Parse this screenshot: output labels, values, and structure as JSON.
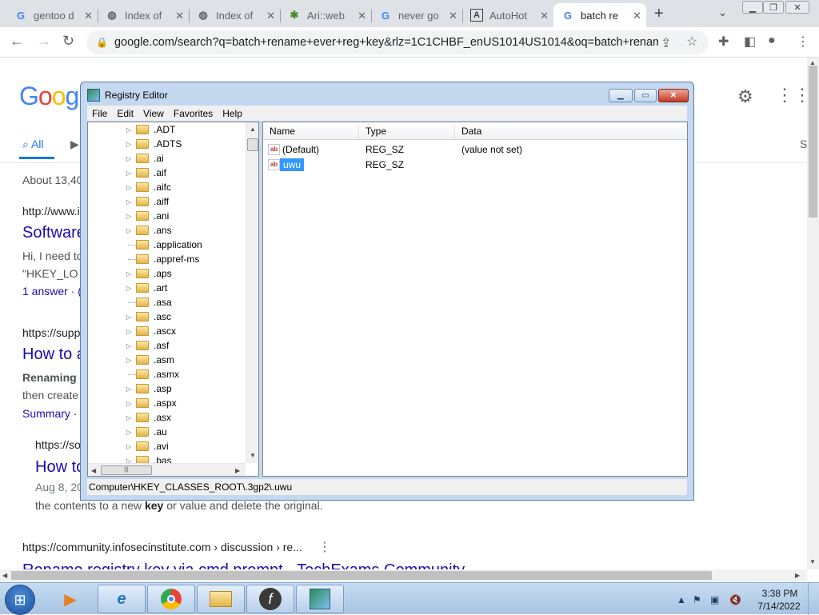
{
  "browser": {
    "tabs": [
      {
        "title": "gentoo d",
        "icon": "google-icon",
        "active": false
      },
      {
        "title": "Index of",
        "icon": "globe-icon",
        "active": false
      },
      {
        "title": "Index of",
        "icon": "globe-icon",
        "active": false
      },
      {
        "title": "Ari::web",
        "icon": "aria-icon",
        "active": false
      },
      {
        "title": "never go",
        "icon": "google-icon",
        "active": false
      },
      {
        "title": "AutoHot",
        "icon": "autohotkey-icon",
        "active": false
      },
      {
        "title": "batch re",
        "icon": "google-icon",
        "active": true
      }
    ],
    "url": "google.com/search?q=batch+rename+ever+reg+key&rlz=1C1CHBF_enUS1014US1014&oq=batch+renam..."
  },
  "google": {
    "logo": "Google",
    "tab_all": "All",
    "results_count": "About 13,40",
    "tab_s": "S",
    "results": [
      {
        "cite": "http://www.i",
        "title": "Software",
        "snippet1": "Hi, I need to",
        "snippet2": "\"HKEY_LO",
        "meta": "1 answer · ("
      },
      {
        "cite": "https://supp",
        "title": "How to a",
        "snippet1": "Renaming R",
        "snippet2": "then create",
        "meta": "Summary ·"
      },
      {
        "cite": "https://so",
        "title": "How to",
        "date": "Aug 8, 20",
        "snippet_full_a": "the contents to a new ",
        "snippet_key": "key",
        "snippet_full_b": " or value and delete the original."
      },
      {
        "cite": "https://community.infosecinstitute.com › discussion › re...",
        "title": "Rename registry key via cmd prompt - TechExams Community"
      }
    ]
  },
  "regedit": {
    "title": "Registry Editor",
    "menu": [
      "File",
      "Edit",
      "View",
      "Favorites",
      "Help"
    ],
    "tree": [
      {
        "label": ".ADT",
        "expandable": true
      },
      {
        "label": ".ADTS",
        "expandable": true
      },
      {
        "label": ".ai",
        "expandable": true
      },
      {
        "label": ".aif",
        "expandable": true
      },
      {
        "label": ".aifc",
        "expandable": true
      },
      {
        "label": ".aiff",
        "expandable": true
      },
      {
        "label": ".ani",
        "expandable": true
      },
      {
        "label": ".ans",
        "expandable": true
      },
      {
        "label": ".application",
        "expandable": false
      },
      {
        "label": ".appref-ms",
        "expandable": false
      },
      {
        "label": ".aps",
        "expandable": true
      },
      {
        "label": ".art",
        "expandable": true
      },
      {
        "label": ".asa",
        "expandable": false
      },
      {
        "label": ".asc",
        "expandable": true
      },
      {
        "label": ".ascx",
        "expandable": true
      },
      {
        "label": ".asf",
        "expandable": true
      },
      {
        "label": ".asm",
        "expandable": true
      },
      {
        "label": ".asmx",
        "expandable": false
      },
      {
        "label": ".asp",
        "expandable": true
      },
      {
        "label": ".aspx",
        "expandable": true
      },
      {
        "label": ".asx",
        "expandable": true
      },
      {
        "label": ".au",
        "expandable": true
      },
      {
        "label": ".avi",
        "expandable": true
      },
      {
        "label": ".bas",
        "expandable": true
      }
    ],
    "columns": [
      "Name",
      "Type",
      "Data"
    ],
    "values": [
      {
        "name": "(Default)",
        "type": "REG_SZ",
        "data": "(value not set)",
        "selected": false
      },
      {
        "name": "uwu",
        "type": "REG_SZ",
        "data": "",
        "selected": true
      }
    ],
    "status_path": "Computer\\HKEY_CLASSES_ROOT\\.3gp2\\.uwu"
  },
  "taskbar": {
    "clock_time": "3:38 PM",
    "clock_date": "7/14/2022",
    "apps": [
      "media-player-icon",
      "internet-explorer-icon",
      "chrome-icon",
      "file-explorer-icon",
      "flash-icon",
      "registry-editor-icon"
    ]
  },
  "colors": {
    "selection": "#3399ff",
    "google_blue": "#4285f4",
    "google_red": "#ea4335",
    "google_yellow": "#fbbc05",
    "google_green": "#34a853",
    "link": "#1a0dab"
  }
}
